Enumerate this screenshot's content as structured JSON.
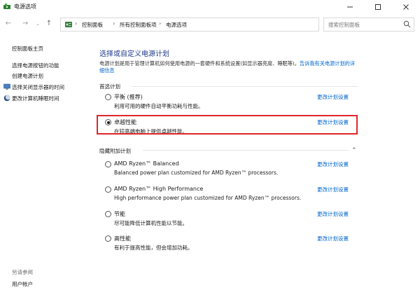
{
  "window": {
    "title": "电源选项",
    "min_icon": "minimize-icon",
    "max_icon": "maximize-icon",
    "close_icon": "close-icon"
  },
  "address": {
    "crumbs": [
      "控制面板",
      "所有控制面板项",
      "电源选项"
    ],
    "search_placeholder": "搜索控制面板"
  },
  "sidebar": {
    "items": [
      {
        "label": "控制面板主页"
      },
      {
        "label": "选择电源按钮的功能"
      },
      {
        "label": "创建电源计划"
      },
      {
        "label": "选择关闭显示器的时间",
        "icon": "monitor-icon"
      },
      {
        "label": "更改计算机睡眠时间",
        "icon": "moon-icon"
      }
    ],
    "see_also_header": "另请参阅",
    "see_also_items": [
      {
        "label": "用户帐户"
      }
    ]
  },
  "main": {
    "title": "选择或自定义电源计划",
    "description": "电源计划是用于管理计算机如何使用电源的一套硬件和系统设置(如显示器亮度、睡眠等)。",
    "description_link": "告诉我有关电源计划的详细信息",
    "preferred_label": "首选计划",
    "hidden_label": "隐藏附加计划",
    "change_label": "更改计划设置",
    "preferred_plans": [
      {
        "name": "平衡 (推荐)",
        "desc": "利用可用的硬件自动平衡功耗与性能。",
        "selected": false
      },
      {
        "name": "卓越性能",
        "desc": "在较高端电脑上提供卓越性能。",
        "selected": true
      }
    ],
    "hidden_plans": [
      {
        "name": "AMD Ryzen™ Balanced",
        "desc": "Balanced power plan customized for AMD Ryzen™ processors.",
        "selected": false
      },
      {
        "name": "AMD Ryzen™ High Performance",
        "desc": "High performance power plan customized for AMD Ryzen™ processors.",
        "selected": false
      },
      {
        "name": "节能",
        "desc": "尽可能降低计算机性能以节能。",
        "selected": false
      },
      {
        "name": "高性能",
        "desc": "有利于提高性能，但会增加功耗。",
        "selected": false
      }
    ]
  },
  "colors": {
    "link": "#0066cc",
    "title": "#1e3a8a",
    "highlight": "#e0262a"
  }
}
